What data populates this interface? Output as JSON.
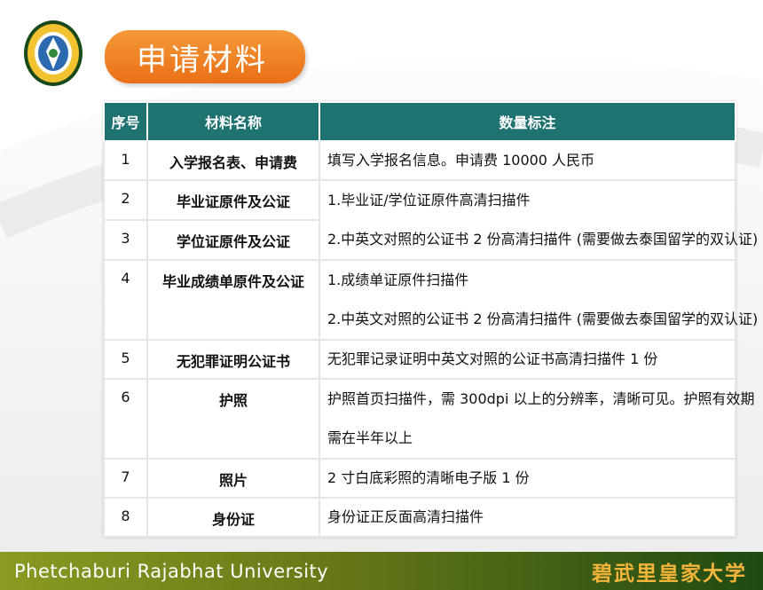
{
  "slide": {
    "title": "申请材料"
  },
  "table": {
    "headers": [
      "序号",
      "材料名称",
      "数量标注"
    ],
    "rows": [
      {
        "seq": "1",
        "name": "入学报名表、申请费",
        "note": [
          "填写入学报名信息。申请费 10000 人民币"
        ]
      },
      {
        "seq": "2",
        "name": "毕业证原件及公证"
      },
      {
        "seq": "3",
        "name": "学位证原件及公证"
      },
      {
        "seq": "4",
        "name": "毕业成绩单原件及公证",
        "note": [
          "1.成绩单证原件扫描件",
          "2.中英文对照的公证书 2 份高清扫描件 (需要做去泰国留学的双认证)"
        ]
      },
      {
        "seq": "5",
        "name": "无犯罪证明公证书",
        "note": [
          "无犯罪记录证明中英文对照的公证书高清扫描件 1 份"
        ]
      },
      {
        "seq": "6",
        "name": "护照",
        "note": [
          "护照首页扫描件，需 300dpi 以上的分辨率，清晰可见。护照有效期",
          "需在半年以上"
        ]
      },
      {
        "seq": "7",
        "name": "照片",
        "note": [
          "2 寸白底彩照的清晰电子版 1 份"
        ]
      },
      {
        "seq": "8",
        "name": "身份证",
        "note": [
          "身份证正反面高清扫描件"
        ]
      }
    ],
    "merged_note_2_3": [
      "1.毕业证/学位证原件高清扫描件",
      "2.中英文对照的公证书 2 份高清扫描件 (需要做去泰国留学的双认证)"
    ]
  },
  "footer": {
    "university_en": "Phetchaburi Rajabhat University",
    "university_cn": "碧武里皇家大学"
  },
  "colors": {
    "header_teal": "#1e7270",
    "title_orange": "#ea6f16",
    "footer_green": "#6b7a18",
    "footer_cn_gold": "#f5b43a"
  }
}
